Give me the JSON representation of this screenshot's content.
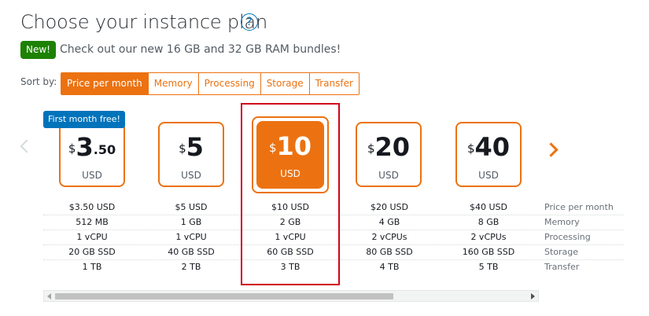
{
  "header": {
    "title": "Choose your instance plan",
    "help_glyph": "?"
  },
  "announcement": {
    "badge": "New!",
    "message": "Check out our new 16 GB and 32 GB RAM bundles!"
  },
  "sort": {
    "label": "Sort by:",
    "options": [
      "Price per month",
      "Memory",
      "Processing",
      "Storage",
      "Transfer"
    ],
    "active": "Price per month"
  },
  "promo_label": "First month free!",
  "currency_symbol": "$",
  "plans": [
    {
      "dollars": "3",
      "cents": ".50",
      "unit": "USD",
      "price": "$3.50 USD",
      "memory": "512 MB",
      "processing": "1 vCPU",
      "storage": "20 GB SSD",
      "transfer": "1 TB"
    },
    {
      "dollars": "5",
      "cents": "",
      "unit": "USD",
      "price": "$5 USD",
      "memory": "1 GB",
      "processing": "1 vCPU",
      "storage": "40 GB SSD",
      "transfer": "2 TB"
    },
    {
      "dollars": "10",
      "cents": "",
      "unit": "USD",
      "price": "$10 USD",
      "memory": "2 GB",
      "processing": "1 vCPU",
      "storage": "60 GB SSD",
      "transfer": "3 TB",
      "selected": true
    },
    {
      "dollars": "20",
      "cents": "",
      "unit": "USD",
      "price": "$20 USD",
      "memory": "4 GB",
      "processing": "2 vCPUs",
      "storage": "80 GB SSD",
      "transfer": "4 TB"
    },
    {
      "dollars": "40",
      "cents": "",
      "unit": "USD",
      "price": "$40 USD",
      "memory": "8 GB",
      "processing": "2 vCPUs",
      "storage": "160 GB SSD",
      "transfer": "5 TB"
    }
  ],
  "spec_labels": [
    "Price per month",
    "Memory",
    "Processing",
    "Storage",
    "Transfer"
  ],
  "colors": {
    "accent": "#ec7211",
    "promo": "#0073bb",
    "new_badge": "#1d8102",
    "highlight": "#d0021b"
  }
}
